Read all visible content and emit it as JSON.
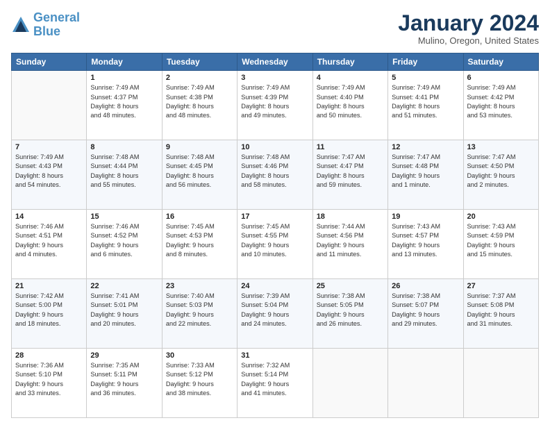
{
  "header": {
    "logo_line1": "General",
    "logo_line2": "Blue",
    "month": "January 2024",
    "location": "Mulino, Oregon, United States"
  },
  "days_of_week": [
    "Sunday",
    "Monday",
    "Tuesday",
    "Wednesday",
    "Thursday",
    "Friday",
    "Saturday"
  ],
  "weeks": [
    [
      {
        "num": "",
        "info": ""
      },
      {
        "num": "1",
        "info": "Sunrise: 7:49 AM\nSunset: 4:37 PM\nDaylight: 8 hours\nand 48 minutes."
      },
      {
        "num": "2",
        "info": "Sunrise: 7:49 AM\nSunset: 4:38 PM\nDaylight: 8 hours\nand 48 minutes."
      },
      {
        "num": "3",
        "info": "Sunrise: 7:49 AM\nSunset: 4:39 PM\nDaylight: 8 hours\nand 49 minutes."
      },
      {
        "num": "4",
        "info": "Sunrise: 7:49 AM\nSunset: 4:40 PM\nDaylight: 8 hours\nand 50 minutes."
      },
      {
        "num": "5",
        "info": "Sunrise: 7:49 AM\nSunset: 4:41 PM\nDaylight: 8 hours\nand 51 minutes."
      },
      {
        "num": "6",
        "info": "Sunrise: 7:49 AM\nSunset: 4:42 PM\nDaylight: 8 hours\nand 53 minutes."
      }
    ],
    [
      {
        "num": "7",
        "info": "Sunrise: 7:49 AM\nSunset: 4:43 PM\nDaylight: 8 hours\nand 54 minutes."
      },
      {
        "num": "8",
        "info": "Sunrise: 7:48 AM\nSunset: 4:44 PM\nDaylight: 8 hours\nand 55 minutes."
      },
      {
        "num": "9",
        "info": "Sunrise: 7:48 AM\nSunset: 4:45 PM\nDaylight: 8 hours\nand 56 minutes."
      },
      {
        "num": "10",
        "info": "Sunrise: 7:48 AM\nSunset: 4:46 PM\nDaylight: 8 hours\nand 58 minutes."
      },
      {
        "num": "11",
        "info": "Sunrise: 7:47 AM\nSunset: 4:47 PM\nDaylight: 8 hours\nand 59 minutes."
      },
      {
        "num": "12",
        "info": "Sunrise: 7:47 AM\nSunset: 4:48 PM\nDaylight: 9 hours\nand 1 minute."
      },
      {
        "num": "13",
        "info": "Sunrise: 7:47 AM\nSunset: 4:50 PM\nDaylight: 9 hours\nand 2 minutes."
      }
    ],
    [
      {
        "num": "14",
        "info": "Sunrise: 7:46 AM\nSunset: 4:51 PM\nDaylight: 9 hours\nand 4 minutes."
      },
      {
        "num": "15",
        "info": "Sunrise: 7:46 AM\nSunset: 4:52 PM\nDaylight: 9 hours\nand 6 minutes."
      },
      {
        "num": "16",
        "info": "Sunrise: 7:45 AM\nSunset: 4:53 PM\nDaylight: 9 hours\nand 8 minutes."
      },
      {
        "num": "17",
        "info": "Sunrise: 7:45 AM\nSunset: 4:55 PM\nDaylight: 9 hours\nand 10 minutes."
      },
      {
        "num": "18",
        "info": "Sunrise: 7:44 AM\nSunset: 4:56 PM\nDaylight: 9 hours\nand 11 minutes."
      },
      {
        "num": "19",
        "info": "Sunrise: 7:43 AM\nSunset: 4:57 PM\nDaylight: 9 hours\nand 13 minutes."
      },
      {
        "num": "20",
        "info": "Sunrise: 7:43 AM\nSunset: 4:59 PM\nDaylight: 9 hours\nand 15 minutes."
      }
    ],
    [
      {
        "num": "21",
        "info": "Sunrise: 7:42 AM\nSunset: 5:00 PM\nDaylight: 9 hours\nand 18 minutes."
      },
      {
        "num": "22",
        "info": "Sunrise: 7:41 AM\nSunset: 5:01 PM\nDaylight: 9 hours\nand 20 minutes."
      },
      {
        "num": "23",
        "info": "Sunrise: 7:40 AM\nSunset: 5:03 PM\nDaylight: 9 hours\nand 22 minutes."
      },
      {
        "num": "24",
        "info": "Sunrise: 7:39 AM\nSunset: 5:04 PM\nDaylight: 9 hours\nand 24 minutes."
      },
      {
        "num": "25",
        "info": "Sunrise: 7:38 AM\nSunset: 5:05 PM\nDaylight: 9 hours\nand 26 minutes."
      },
      {
        "num": "26",
        "info": "Sunrise: 7:38 AM\nSunset: 5:07 PM\nDaylight: 9 hours\nand 29 minutes."
      },
      {
        "num": "27",
        "info": "Sunrise: 7:37 AM\nSunset: 5:08 PM\nDaylight: 9 hours\nand 31 minutes."
      }
    ],
    [
      {
        "num": "28",
        "info": "Sunrise: 7:36 AM\nSunset: 5:10 PM\nDaylight: 9 hours\nand 33 minutes."
      },
      {
        "num": "29",
        "info": "Sunrise: 7:35 AM\nSunset: 5:11 PM\nDaylight: 9 hours\nand 36 minutes."
      },
      {
        "num": "30",
        "info": "Sunrise: 7:33 AM\nSunset: 5:12 PM\nDaylight: 9 hours\nand 38 minutes."
      },
      {
        "num": "31",
        "info": "Sunrise: 7:32 AM\nSunset: 5:14 PM\nDaylight: 9 hours\nand 41 minutes."
      },
      {
        "num": "",
        "info": ""
      },
      {
        "num": "",
        "info": ""
      },
      {
        "num": "",
        "info": ""
      }
    ]
  ]
}
